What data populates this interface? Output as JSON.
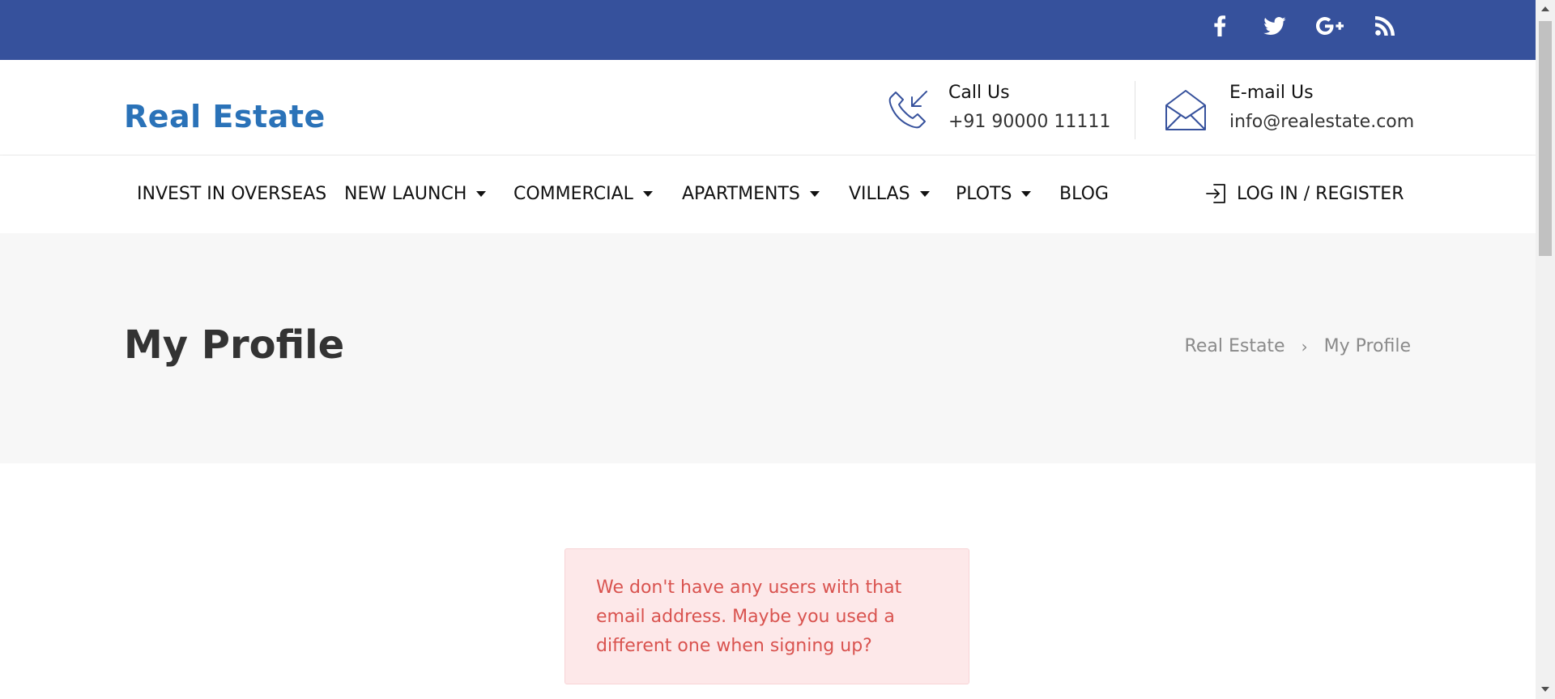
{
  "social": [
    "facebook-icon",
    "twitter-icon",
    "google-plus-icon",
    "rss-icon"
  ],
  "brand": {
    "name": "Real Estate",
    "color": "#2a72b8",
    "topbar_color": "#36519c"
  },
  "contact": {
    "call_title": "Call Us",
    "call_value": "+91 90000 11111",
    "email_title": "E-mail Us",
    "email_value": "info@realestate.com"
  },
  "nav": {
    "items": [
      {
        "label": "INVEST IN OVERSEAS",
        "dropdown": false
      },
      {
        "label": "NEW LAUNCH",
        "dropdown": true
      },
      {
        "label": "COMMERCIAL",
        "dropdown": true
      },
      {
        "label": "APARTMENTS",
        "dropdown": true
      },
      {
        "label": "VILLAS",
        "dropdown": true
      },
      {
        "label": "PLOTS",
        "dropdown": true
      },
      {
        "label": "BLOG",
        "dropdown": false
      }
    ],
    "login_label": "LOG IN / REGISTER"
  },
  "page": {
    "title": "My Profile",
    "breadcrumb": [
      "Real Estate",
      "My Profile"
    ],
    "breadcrumb_sep": "›"
  },
  "alert": {
    "message": "We don't have any users with that email address. Maybe you used a different one when signing up?",
    "color": "#d9534f"
  }
}
